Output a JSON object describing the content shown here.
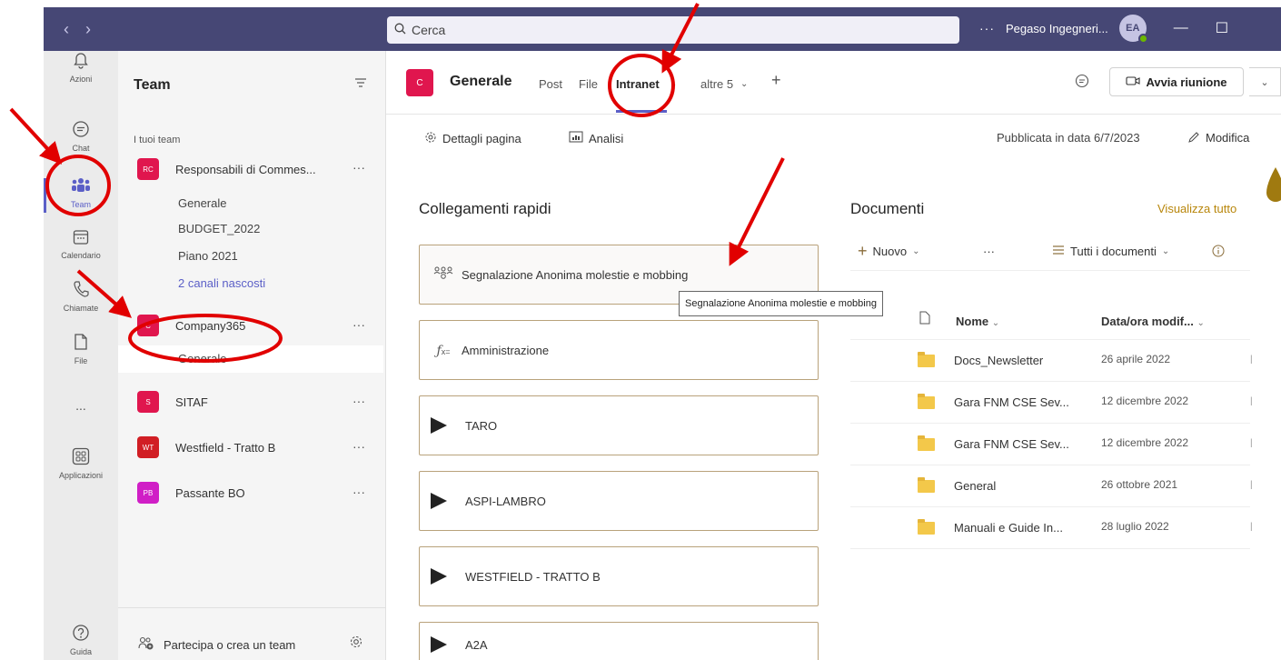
{
  "titlebar": {
    "search_placeholder": "Cerca",
    "tenant": "Pegaso Ingegneri...",
    "avatar_initials": "EA",
    "more": "···"
  },
  "appbar": {
    "items": [
      {
        "label": "Azioni",
        "icon": "bell-icon"
      },
      {
        "label": "Chat",
        "icon": "chat-icon"
      },
      {
        "label": "Team",
        "icon": "teams-icon"
      },
      {
        "label": "Calendario",
        "icon": "calendar-icon"
      },
      {
        "label": "Chiamate",
        "icon": "phone-icon"
      },
      {
        "label": "File",
        "icon": "file-icon"
      },
      {
        "label": "...",
        "icon": "more-icon"
      },
      {
        "label": "Applicazioni",
        "icon": "apps-icon"
      },
      {
        "label": "Guida",
        "icon": "help-icon"
      }
    ]
  },
  "teams_panel": {
    "title": "Team",
    "section": "I tuoi team",
    "teams": [
      {
        "badge": "RC",
        "name": "Responsabili di Commes...",
        "color": "#e0164e"
      },
      {
        "badge": "C",
        "name": "Company365",
        "color": "#e0164e"
      },
      {
        "badge": "S",
        "name": "SITAF",
        "color": "#e0164e"
      },
      {
        "badge": "WT",
        "name": "Westfield - Tratto B",
        "color": "#d11e24"
      },
      {
        "badge": "PB",
        "name": "Passante BO",
        "color": "#d01fc6"
      }
    ],
    "channels_team1": [
      "Generale",
      "BUDGET_2022",
      "Piano 2021",
      "2 canali nascosti"
    ],
    "channels_team2": [
      "Generale"
    ],
    "join": "Partecipa o crea un team"
  },
  "channel": {
    "badge": "C",
    "title": "Generale",
    "tabs": [
      "Post",
      "File",
      "Intranet",
      "altre 5"
    ],
    "meet_button": "Avvia riunione"
  },
  "page_toolbar": {
    "details": "Dettagli pagina",
    "analytics": "Analisi",
    "published": "Pubblicata in data 6/7/2023",
    "edit": "Modifica"
  },
  "quick_links": {
    "title": "Collegamenti rapidi",
    "items": [
      "Segnalazione Anonima molestie e mobbing",
      "Amministrazione",
      "TARO",
      "ASPI-LAMBRO",
      "WESTFIELD - TRATTO B",
      "A2A"
    ],
    "tooltip": "Segnalazione Anonima molestie e mobbing"
  },
  "documents": {
    "title": "Documenti",
    "view_all": "Visualizza tutto",
    "new": "Nuovo",
    "more": "···",
    "view_selector": "Tutti i documenti",
    "col_name": "Nome",
    "col_date": "Data/ora modif...",
    "rows": [
      {
        "name": "Docs_Newsletter",
        "date": "26 aprile 2022"
      },
      {
        "name": "Gara FNM CSE Sev...",
        "date": "12 dicembre 2022"
      },
      {
        "name": "Gara FNM CSE Sev...",
        "date": "12 dicembre 2022"
      },
      {
        "name": "General",
        "date": "26 ottobre 2021"
      },
      {
        "name": "Manuali e Guide In...",
        "date": "28 luglio 2022"
      }
    ]
  }
}
